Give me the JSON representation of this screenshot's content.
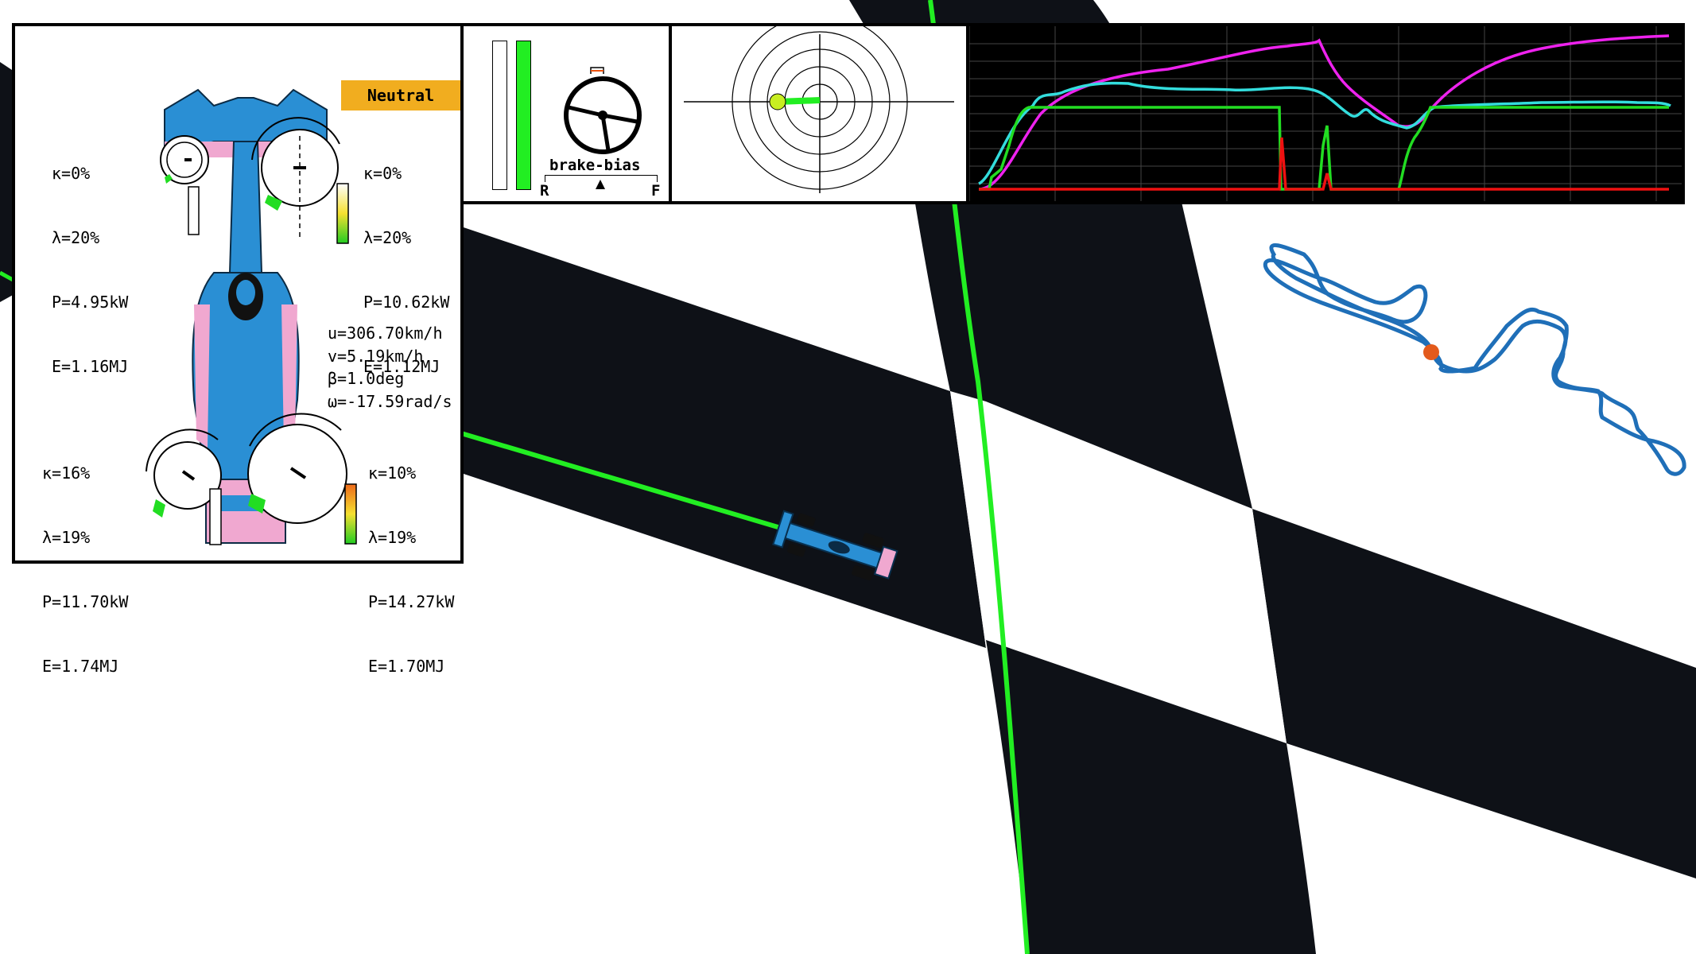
{
  "gear": "Neutral",
  "wheels": {
    "front_left": {
      "kappa": "κ=0%",
      "lambda": "λ=20%",
      "power": "P=4.95kW",
      "energy": "E=1.16MJ"
    },
    "front_right": {
      "kappa": "κ=0%",
      "lambda": "λ=20%",
      "power": "P=10.62kW",
      "energy": "E=1.12MJ"
    },
    "rear_left": {
      "kappa": "κ=16%",
      "lambda": "λ=19%",
      "power": "P=11.70kW",
      "energy": "E=1.74MJ"
    },
    "rear_right": {
      "kappa": "κ=10%",
      "lambda": "λ=19%",
      "power": "P=14.27kW",
      "energy": "E=1.70MJ"
    }
  },
  "vehicle": {
    "u": "u=306.70km/h",
    "v": "v=5.19km/h",
    "beta": "β=1.0deg",
    "omega": "ω=-17.59rad/s"
  },
  "pedals": {
    "brake_fraction": 0.0,
    "throttle_fraction": 1.0
  },
  "brake_bias": {
    "label": "brake-bias",
    "rear_label": "R",
    "front_label": "F",
    "value_fraction": 0.5
  },
  "colors": {
    "gear_badge": "#f1ad1f",
    "track_dark": "#0e1117",
    "racing_line": "#22ee22",
    "car_blue": "#2a8fd4",
    "car_pink": "#f0a8d0",
    "minimap_line": "#1f6fb8",
    "minimap_marker": "#e35a1c",
    "trace_magenta": "#ee22ee",
    "trace_cyan": "#33dddd",
    "trace_green": "#22dd22",
    "trace_red": "#ee1111"
  },
  "icons": {
    "steering": "steering-wheel-icon",
    "car_topview": "race-car-icon",
    "minimap_marker": "position-marker-icon"
  }
}
